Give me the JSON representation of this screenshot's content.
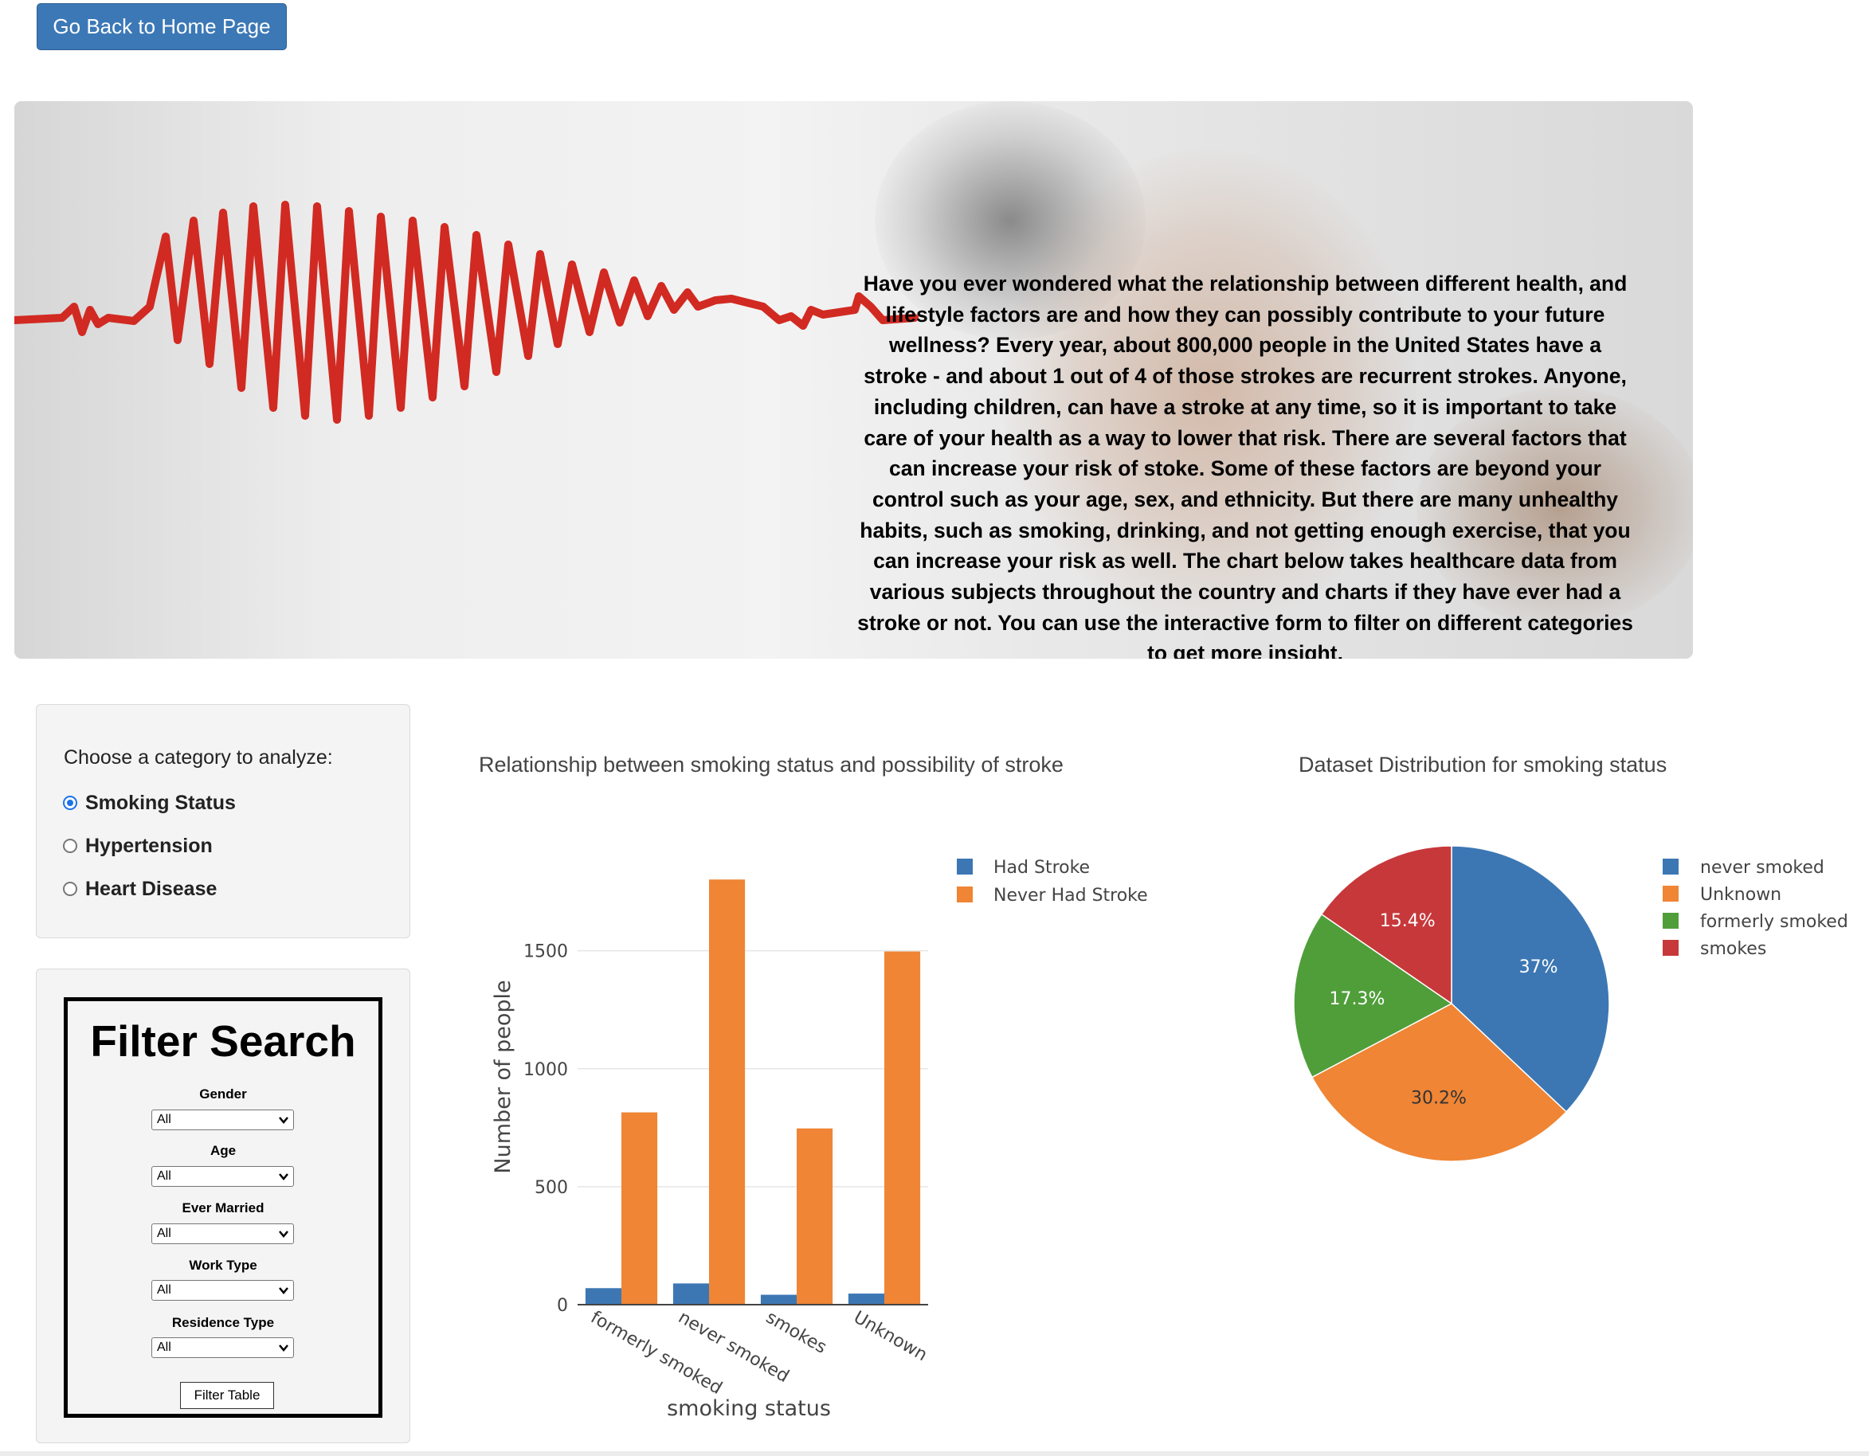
{
  "nav": {
    "home_button": "Go Back to Home Page"
  },
  "hero": {
    "text": "Have you ever wondered what the relationship between different health, and lifestyle factors are and how they can possibly contribute to your future wellness? Every year, about 800,000 people in the United States have a stroke - and about 1 out of 4 of those strokes are recurrent strokes. Anyone, including children, can have a stroke at any time, so it is important to take care of your health as a way to lower that risk. There are several factors that can increase your risk of stoke. Some of these factors are beyond your control such as your age, sex, and ethnicity. But there are many unhealthy habits, such as smoking, drinking, and not getting enough exercise, that you can increase your risk as well. The chart below takes healthcare data from various subjects throughout the country and charts if they have ever had a stroke or not. You can use the interactive form to filter on different categories to get more insight."
  },
  "category": {
    "prompt": "Choose a category to analyze:",
    "options": [
      {
        "label": "Smoking Status",
        "selected": true
      },
      {
        "label": "Hypertension",
        "selected": false
      },
      {
        "label": "Heart Disease",
        "selected": false
      }
    ]
  },
  "filter": {
    "title": "Filter Search",
    "fields": [
      {
        "label": "Gender",
        "value": "All"
      },
      {
        "label": "Age",
        "value": "All"
      },
      {
        "label": "Ever Married",
        "value": "All"
      },
      {
        "label": "Work Type",
        "value": "All"
      },
      {
        "label": "Residence Type",
        "value": "All"
      }
    ],
    "button": "Filter Table"
  },
  "colors": {
    "blue": "#3c77b4",
    "orange": "#ef8535",
    "green": "#4f9e3a",
    "red": "#c7383a"
  },
  "chart_data": [
    {
      "type": "bar",
      "title": "Relationship between smoking status and possibility of stroke",
      "xlabel": "smoking status",
      "ylabel": "Number of people",
      "categories": [
        "formerly smoked",
        "never smoked",
        "smokes",
        "Unknown"
      ],
      "series": [
        {
          "name": "Had Stroke",
          "color": "#3c77b4",
          "values": [
            70,
            90,
            42,
            47
          ]
        },
        {
          "name": "Never Had Stroke",
          "color": "#ef8535",
          "values": [
            815,
            1802,
            747,
            1497
          ]
        }
      ],
      "ylim": [
        0,
        1850
      ],
      "yticks": [
        0,
        500,
        1000,
        1500
      ],
      "legend": "top-right",
      "grid": true
    },
    {
      "type": "pie",
      "title": "Dataset Distribution for smoking status",
      "slices": [
        {
          "label": "never smoked",
          "value": 37,
          "text": "37%",
          "color": "#3c77b4"
        },
        {
          "label": "Unknown",
          "value": 30.2,
          "text": "30.2%",
          "color": "#ef8535"
        },
        {
          "label": "formerly smoked",
          "value": 17.3,
          "text": "17.3%",
          "color": "#4f9e3a"
        },
        {
          "label": "smokes",
          "value": 15.4,
          "text": "15.4%",
          "color": "#c7383a"
        }
      ],
      "legend": "right"
    }
  ]
}
